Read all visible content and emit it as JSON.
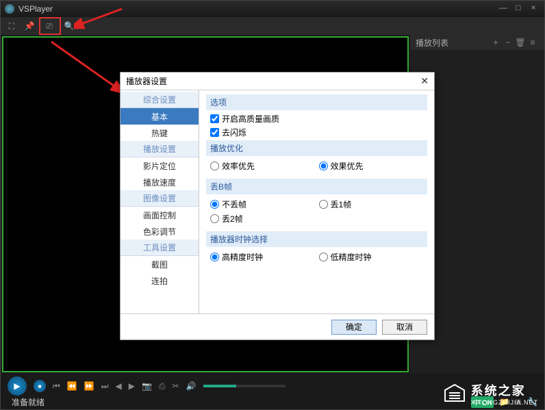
{
  "app": {
    "title": "VSPlayer"
  },
  "titlebar_buttons": {
    "minimize": "—",
    "maximize": "□",
    "close": "×"
  },
  "playlist": {
    "title": "播放列表",
    "add": "+",
    "remove": "−",
    "delete": "🗑",
    "menu": "≡"
  },
  "status": "准备就绪",
  "dialog": {
    "title": "播放器设置",
    "nav_groups": {
      "g1": "综合设置",
      "g1_items": {
        "basic": "基本",
        "hotkey": "热键"
      },
      "g2": "播放设置",
      "g2_items": {
        "seek": "影片定位",
        "speed": "播放速度"
      },
      "g3": "图像设置",
      "g3_items": {
        "picture": "画面控制",
        "color": "色彩调节"
      },
      "g4": "工具设置",
      "g4_items": {
        "screenshot": "截图",
        "burst": "连拍"
      }
    },
    "sections": {
      "options": "选项",
      "opt_hq": "开启高质量画质",
      "opt_flicker": "去闪烁",
      "playback_opt": "播放优化",
      "po_eff": "效率优先",
      "po_quality": "效果优先",
      "drop_b": "丢B帧",
      "db_none": "不丢帧",
      "db_1": "丢1帧",
      "db_2": "丢2帧",
      "clock": "播放器时钟选择",
      "clock_hi": "高精度时钟",
      "clock_lo": "低精度时钟"
    },
    "ok": "确定",
    "cancel": "取消"
  },
  "watermark": {
    "brand": "系统之家",
    "url": "XITONGZHIJIA.NET"
  },
  "badges": {
    "ch": "中 CH"
  }
}
